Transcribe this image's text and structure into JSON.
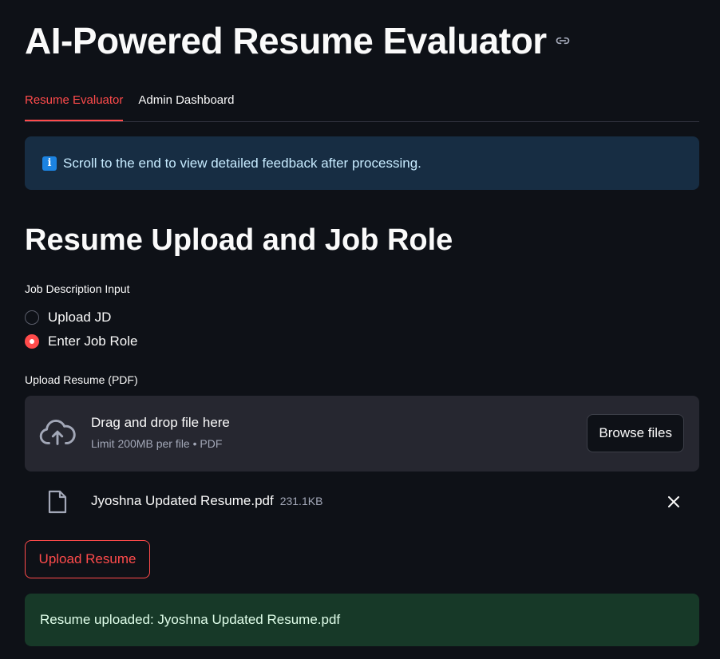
{
  "app": {
    "title": "AI-Powered Resume Evaluator",
    "link_icon": "link-icon"
  },
  "tabs": [
    {
      "label": "Resume Evaluator",
      "active": true
    },
    {
      "label": "Admin Dashboard",
      "active": false
    }
  ],
  "info": {
    "icon": "info-icon",
    "icon_glyph": "i",
    "text": "Scroll to the end to view detailed feedback after processing."
  },
  "section": {
    "title": "Resume Upload and Job Role"
  },
  "jd_input": {
    "label": "Job Description Input",
    "options": [
      {
        "label": "Upload JD",
        "selected": false
      },
      {
        "label": "Enter Job Role",
        "selected": true
      }
    ]
  },
  "resume_upload": {
    "label": "Upload Resume (PDF)",
    "dropzone_title": "Drag and drop file here",
    "dropzone_sub": "Limit 200MB per file • PDF",
    "browse_label": "Browse files",
    "file": {
      "name": "Jyoshna Updated Resume.pdf",
      "size": "231.1KB"
    }
  },
  "upload_button": {
    "label": "Upload Resume"
  },
  "success": {
    "text": "Resume uploaded: Jyoshna Updated Resume.pdf"
  },
  "colors": {
    "background": "#0e1117",
    "accent": "#ff4b4b",
    "info_bg": "#172d43",
    "success_bg": "#173928"
  }
}
